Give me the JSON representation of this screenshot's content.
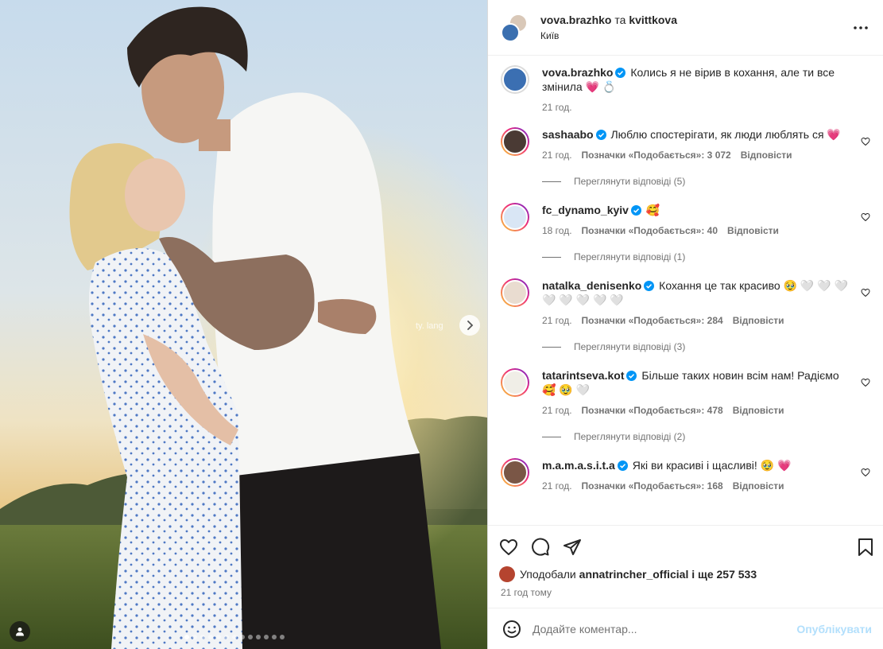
{
  "header": {
    "user1": "vova.brazhko",
    "conj": "та",
    "user2": "kvittkova",
    "location": "Київ"
  },
  "caption": {
    "username": "vova.brazhko",
    "text": "Колись я не вірив в кохання, але ти все змінила 💗 💍",
    "time": "21 год."
  },
  "comments": [
    {
      "username": "sashaabo",
      "text": "Люблю спостерігати, як люди люблять ся 💗",
      "time": "21 год.",
      "likes": "Позначки «Подобається»: 3 072",
      "reply": "Відповісти",
      "view_replies": "Переглянути відповіді (5)"
    },
    {
      "username": "fc_dynamo_kyiv",
      "text": "🥰",
      "time": "18 год.",
      "likes": "Позначки «Подобається»: 40",
      "reply": "Відповісти",
      "view_replies": "Переглянути відповіді (1)"
    },
    {
      "username": "natalka_denisenko",
      "text": "Кохання це так красиво 🥹 🤍 🤍 🤍 🤍 🤍 🤍 🤍 🤍",
      "time": "21 год.",
      "likes": "Позначки «Подобається»: 284",
      "reply": "Відповісти",
      "view_replies": "Переглянути відповіді (3)"
    },
    {
      "username": "tatarintseva.kot",
      "text": "Більше таких новин всім нам! Радіємо 🥰 🥹 🤍",
      "time": "21 год.",
      "likes": "Позначки «Подобається»: 478",
      "reply": "Відповісти",
      "view_replies": "Переглянути відповіді (2)"
    },
    {
      "username": "m.a.m.a.s.i.t.a",
      "text": "Які ви красиві і щасливі! 🥹 💗",
      "time": "21 год.",
      "likes": "Позначки «Подобається»: 168",
      "reply": "Відповісти",
      "view_replies": ""
    }
  ],
  "likes": {
    "prefix": "Уподобали",
    "user": "annatrincher_official",
    "suffix": "і ще 257 533",
    "time": "21 год тому"
  },
  "add_comment": {
    "placeholder": "Додайте коментар...",
    "publish": "Опублікувати"
  },
  "carousel": {
    "count": 13,
    "active": 1
  },
  "colors": {
    "verified": "#0095f6",
    "muted": "#737373",
    "publish_disabled": "#b2dffc",
    "text": "#262626"
  }
}
